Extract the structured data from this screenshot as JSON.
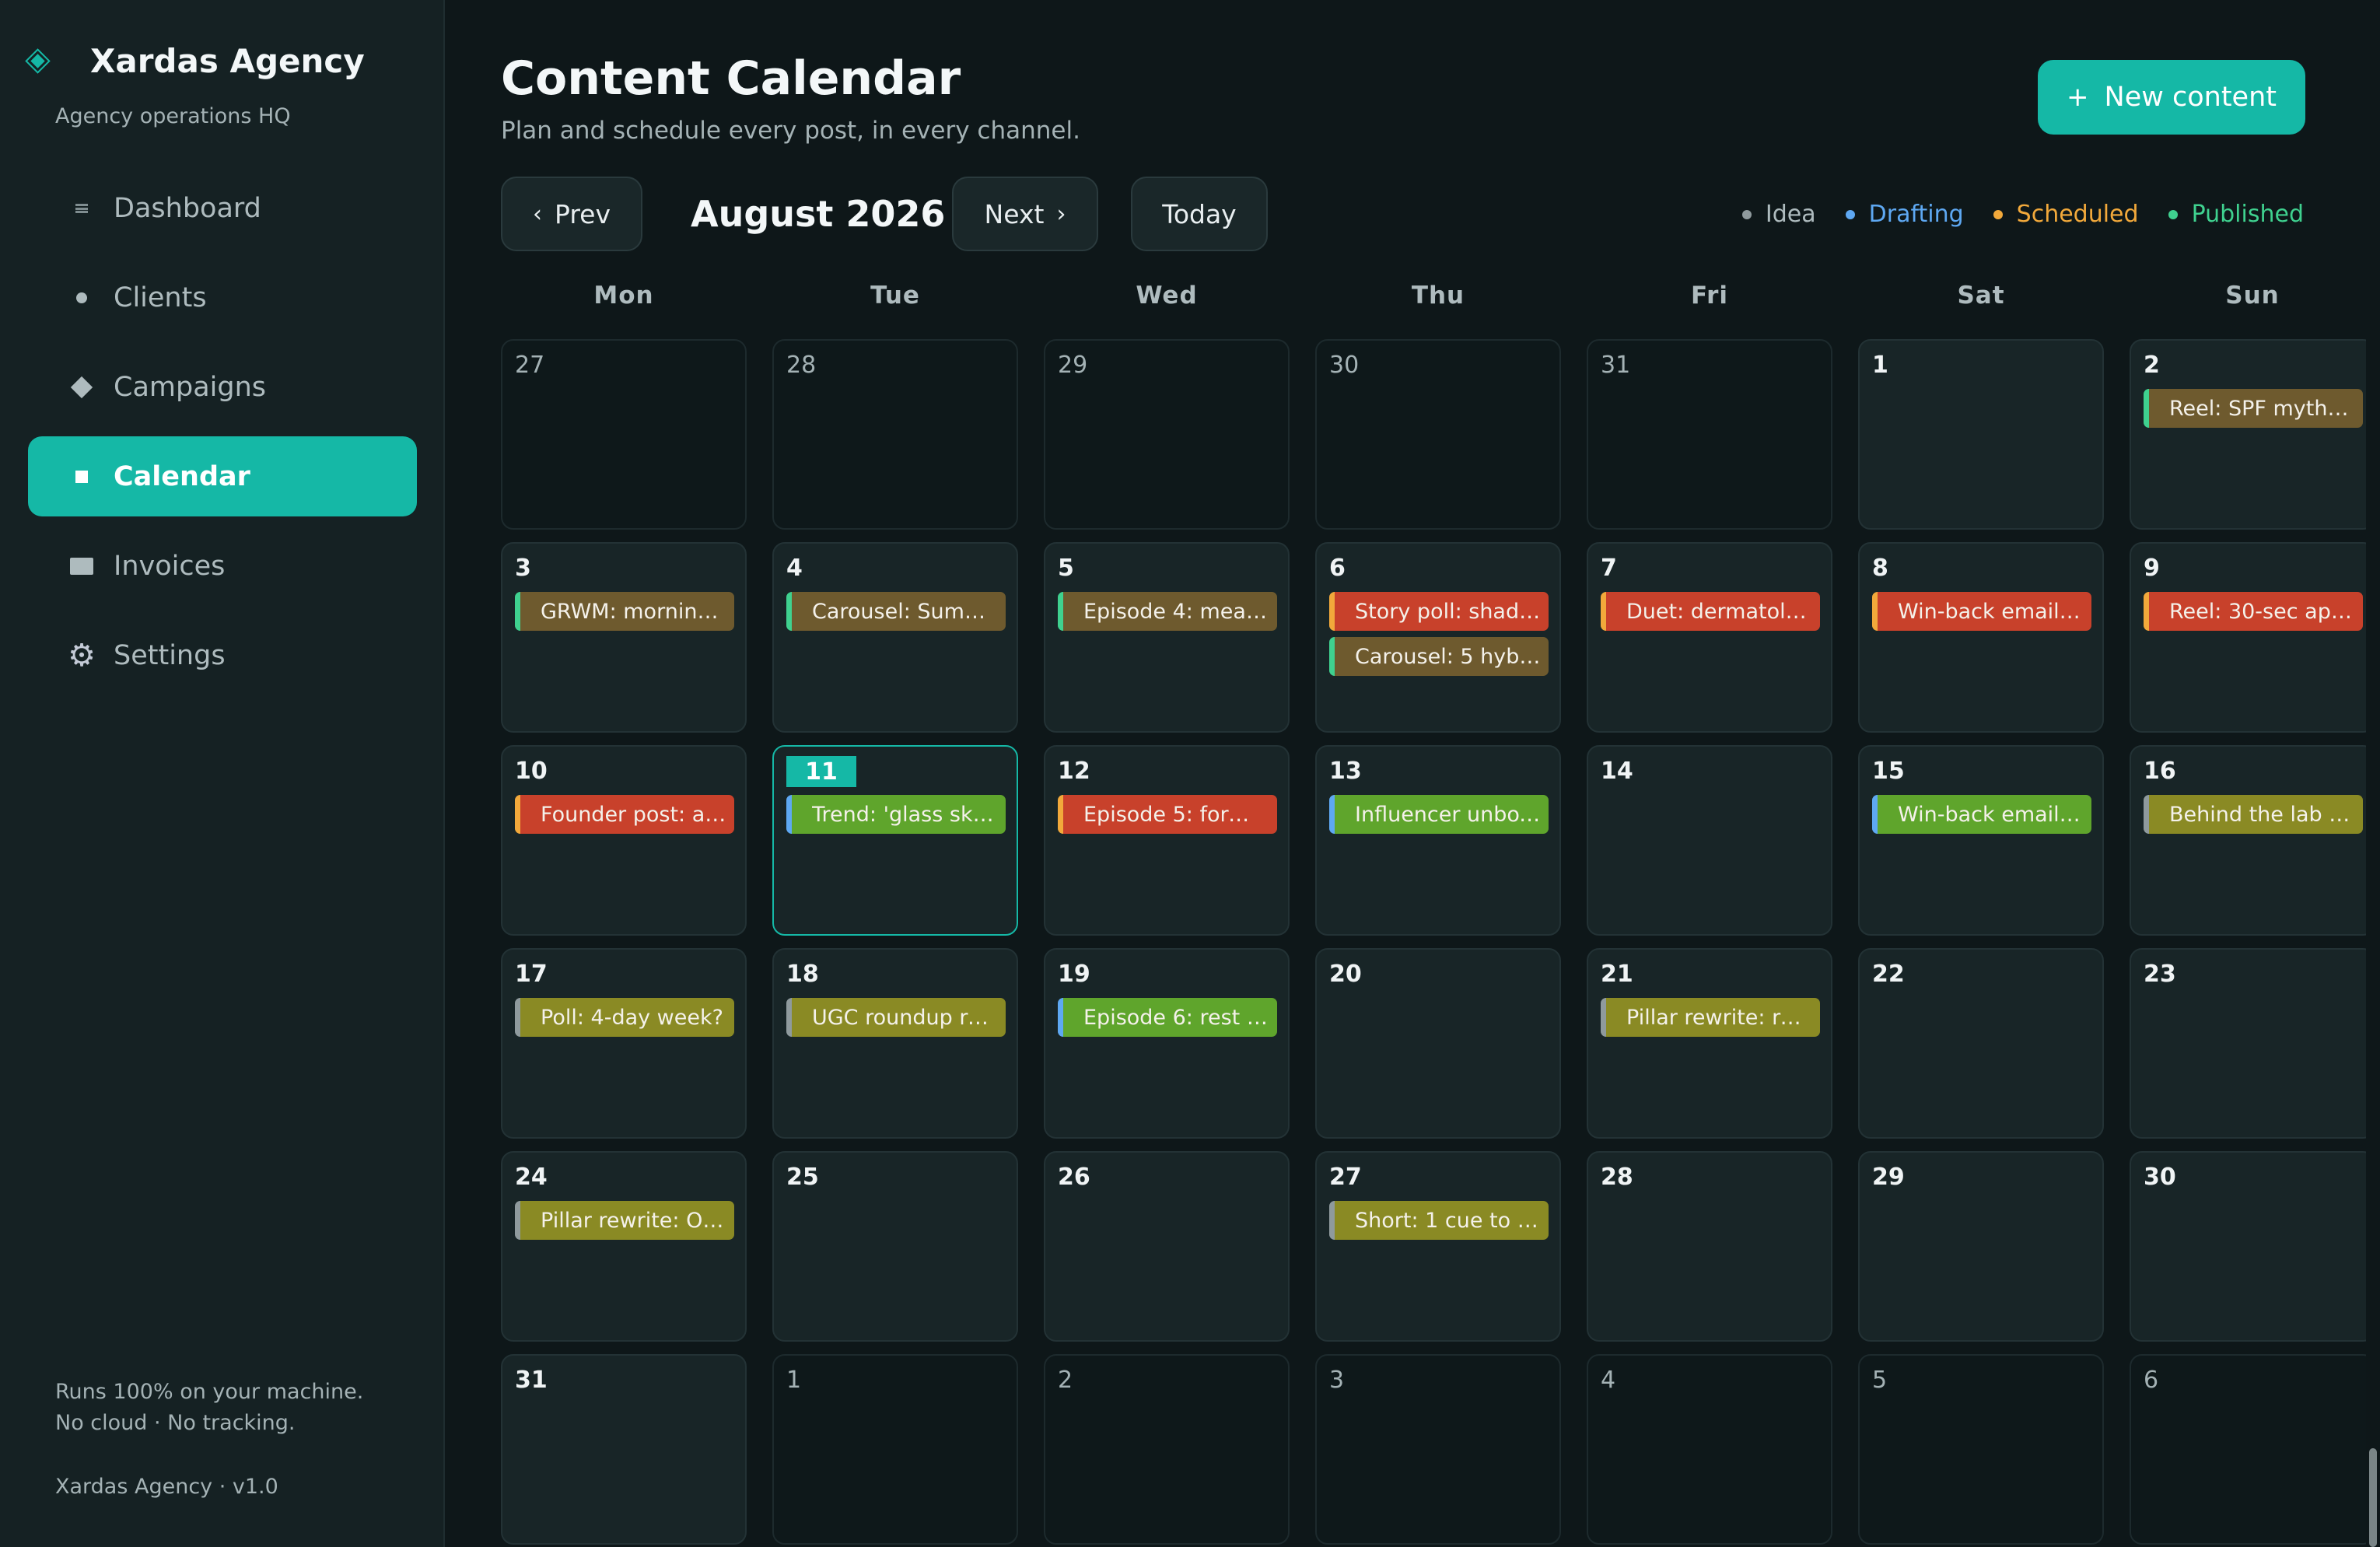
{
  "colors": {
    "accent": "#15b8a6",
    "status": {
      "idea": "#8f9a9d",
      "drafting": "#5ea8f2",
      "scheduled": "#f2a93b",
      "published": "#3fd18f"
    },
    "event_bg": {
      "brown": "#6e5a2e",
      "red": "#c8412b",
      "green": "#5fa52c",
      "olive": "#8a8a24"
    }
  },
  "sidebar": {
    "brand": {
      "title": "Xardas Agency",
      "subtitle": "Agency operations HQ",
      "icon": "diamond-icon"
    },
    "items": [
      {
        "label": "Dashboard",
        "icon": "dashboard-icon",
        "active": false
      },
      {
        "label": "Clients",
        "icon": "dot-icon",
        "active": false
      },
      {
        "label": "Campaigns",
        "icon": "diamond-icon",
        "active": false
      },
      {
        "label": "Calendar",
        "icon": "square-icon",
        "active": true
      },
      {
        "label": "Invoices",
        "icon": "rectangle-icon",
        "active": false
      },
      {
        "label": "Settings",
        "icon": "gear-icon",
        "active": false
      }
    ],
    "footer": {
      "line1": "Runs 100% on your machine.",
      "line2": "No cloud · No tracking.",
      "version": "Xardas Agency · v1.0"
    }
  },
  "header": {
    "title": "Content Calendar",
    "subtitle": "Plan and schedule every post, in every channel.",
    "new_button": "New content",
    "new_button_icon": "+"
  },
  "toolbar": {
    "prev": "Prev",
    "prev_icon": "‹",
    "month": "August 2026",
    "next": "Next",
    "next_icon": "›",
    "today": "Today"
  },
  "legend": [
    {
      "label": "Idea",
      "status": "idea"
    },
    {
      "label": "Drafting",
      "status": "drafting"
    },
    {
      "label": "Scheduled",
      "status": "scheduled"
    },
    {
      "label": "Published",
      "status": "published"
    }
  ],
  "weekdays": [
    "Mon",
    "Tue",
    "Wed",
    "Thu",
    "Fri",
    "Sat",
    "Sun"
  ],
  "weeks": [
    [
      {
        "day": "27",
        "out": true,
        "events": []
      },
      {
        "day": "28",
        "out": true,
        "events": []
      },
      {
        "day": "29",
        "out": true,
        "events": []
      },
      {
        "day": "30",
        "out": true,
        "events": []
      },
      {
        "day": "31",
        "out": true,
        "events": []
      },
      {
        "day": "1",
        "events": []
      },
      {
        "day": "2",
        "events": [
          {
            "title": "Reel: SPF myths d...",
            "status": "published",
            "bg": "brown"
          }
        ]
      }
    ],
    [
      {
        "day": "3",
        "events": [
          {
            "title": "GRWM: morning r...",
            "status": "published",
            "bg": "brown"
          }
        ]
      },
      {
        "day": "4",
        "events": [
          {
            "title": "Carousel: Summer...",
            "status": "published",
            "bg": "brown"
          }
        ]
      },
      {
        "day": "5",
        "events": [
          {
            "title": "Episode 4: meal p...",
            "status": "published",
            "bg": "brown"
          }
        ]
      },
      {
        "day": "6",
        "events": [
          {
            "title": "Story poll: shade ...",
            "status": "scheduled",
            "bg": "red"
          },
          {
            "title": "Carousel: 5 hybrid...",
            "status": "published",
            "bg": "brown"
          }
        ]
      },
      {
        "day": "7",
        "events": [
          {
            "title": "Duet: dermatologi...",
            "status": "scheduled",
            "bg": "red"
          }
        ]
      },
      {
        "day": "8",
        "events": [
          {
            "title": "Win-back email 1:...",
            "status": "scheduled",
            "bg": "red"
          }
        ]
      },
      {
        "day": "9",
        "events": [
          {
            "title": "Reel: 30-sec appli...",
            "status": "scheduled",
            "bg": "red"
          }
        ]
      }
    ],
    [
      {
        "day": "10",
        "events": [
          {
            "title": "Founder post: asy...",
            "status": "scheduled",
            "bg": "red"
          }
        ]
      },
      {
        "day": "11",
        "today": true,
        "events": [
          {
            "title": "Trend: 'glass skin' ...",
            "status": "drafting",
            "bg": "green"
          }
        ]
      },
      {
        "day": "12",
        "events": [
          {
            "title": "Episode 5: form c...",
            "status": "scheduled",
            "bg": "red"
          }
        ]
      },
      {
        "day": "13",
        "events": [
          {
            "title": "Influencer unboxi...",
            "status": "drafting",
            "bg": "green"
          }
        ]
      },
      {
        "day": "14",
        "events": []
      },
      {
        "day": "15",
        "events": [
          {
            "title": "Win-back email 2:...",
            "status": "drafting",
            "bg": "green"
          }
        ]
      },
      {
        "day": "16",
        "events": [
          {
            "title": "Behind the lab tour",
            "status": "idea",
            "bg": "olive"
          }
        ]
      }
    ],
    [
      {
        "day": "17",
        "events": [
          {
            "title": "Poll: 4-day week?",
            "status": "idea",
            "bg": "olive"
          }
        ]
      },
      {
        "day": "18",
        "events": [
          {
            "title": "UGC roundup reel",
            "status": "idea",
            "bg": "olive"
          }
        ]
      },
      {
        "day": "19",
        "events": [
          {
            "title": "Episode 6: rest & r...",
            "status": "drafting",
            "bg": "green"
          }
        ]
      },
      {
        "day": "20",
        "events": []
      },
      {
        "day": "21",
        "events": [
          {
            "title": "Pillar rewrite: rem...",
            "status": "idea",
            "bg": "olive"
          }
        ]
      },
      {
        "day": "22",
        "events": []
      },
      {
        "day": "23",
        "events": []
      }
    ],
    [
      {
        "day": "24",
        "events": [
          {
            "title": "Pillar rewrite: OKR...",
            "status": "idea",
            "bg": "olive"
          }
        ]
      },
      {
        "day": "25",
        "events": []
      },
      {
        "day": "26",
        "events": []
      },
      {
        "day": "27",
        "events": [
          {
            "title": "Short: 1 cue to fix ...",
            "status": "idea",
            "bg": "olive"
          }
        ]
      },
      {
        "day": "28",
        "events": []
      },
      {
        "day": "29",
        "events": []
      },
      {
        "day": "30",
        "events": []
      }
    ],
    [
      {
        "day": "31",
        "events": []
      },
      {
        "day": "1",
        "out": true,
        "events": []
      },
      {
        "day": "2",
        "out": true,
        "events": []
      },
      {
        "day": "3",
        "out": true,
        "events": []
      },
      {
        "day": "4",
        "out": true,
        "events": []
      },
      {
        "day": "5",
        "out": true,
        "events": []
      },
      {
        "day": "6",
        "out": true,
        "events": []
      }
    ]
  ]
}
